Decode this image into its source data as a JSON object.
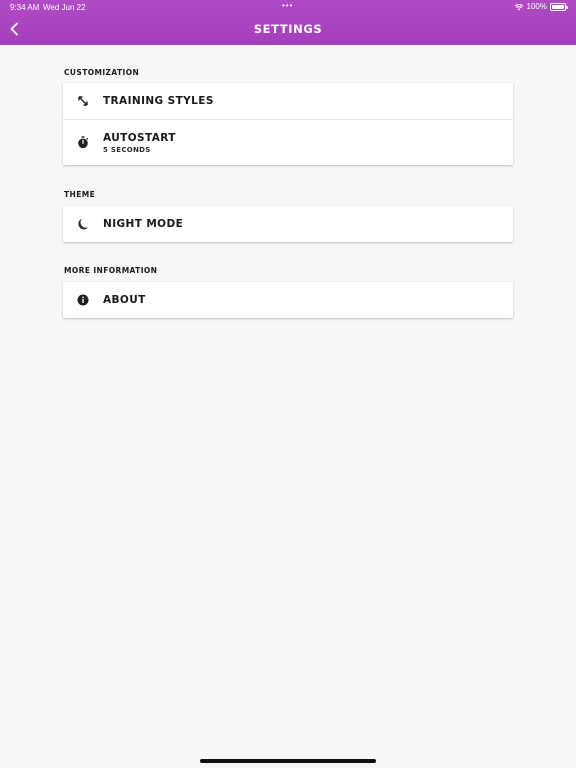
{
  "status_bar": {
    "time": "9:34 AM",
    "date": "Wed Jun 22",
    "dots": "•••",
    "battery": "100%"
  },
  "header": {
    "title": "SETTINGS",
    "background": "#a845bf"
  },
  "sections": [
    {
      "title": "CUSTOMIZATION",
      "items": [
        {
          "label": "TRAINING STYLES",
          "icon": "arrows-diagonal-icon"
        },
        {
          "label": "AUTOSTART",
          "subtitle": "5 SECONDS",
          "icon": "stopwatch-icon"
        }
      ]
    },
    {
      "title": "THEME",
      "items": [
        {
          "label": "NIGHT MODE",
          "icon": "moon-icon"
        }
      ]
    },
    {
      "title": "MORE INFORMATION",
      "items": [
        {
          "label": "ABOUT",
          "icon": "info-icon"
        }
      ]
    }
  ]
}
